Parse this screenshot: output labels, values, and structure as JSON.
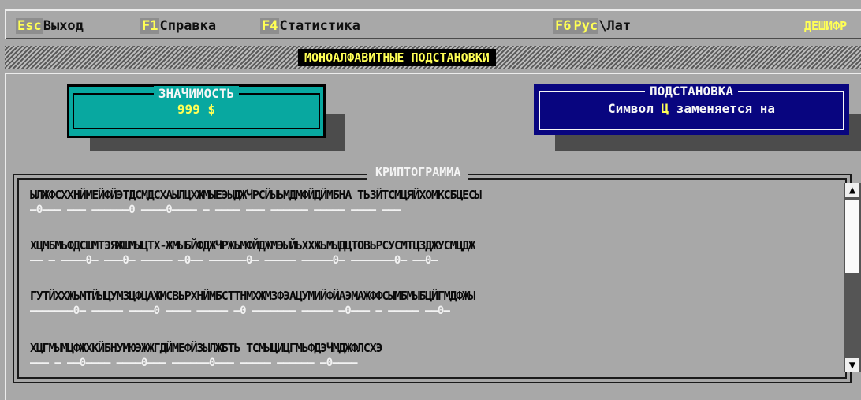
{
  "menu": {
    "esc": {
      "key": "Esc",
      "label": "Выход"
    },
    "f1": {
      "key": "F1",
      "label": "Справка"
    },
    "f4": {
      "key": "F4",
      "label": "Статистика"
    },
    "f6": {
      "key": "F6",
      "label_highlight": "Рус",
      "label_rest": "\\Лат"
    },
    "mode": "ДЕШИФР"
  },
  "title_strip": "МОНОАЛФАВИТНЫЕ ПОДСТАНОВКИ",
  "significance": {
    "title": "ЗНАЧИМОСТЬ",
    "value": "999 $"
  },
  "substitution": {
    "title": "ПОДСТАНОВКА",
    "text_before": "Символ ",
    "char": "Ц",
    "text_after": " заменяется на"
  },
  "cryptogram": {
    "title": "КРИПТОГРАММА",
    "lines": [
      {
        "text": "ЫЛЖФСХХНЙМЕЙФЙЭТДСМДСХАЫЛЦХЖМЫЕЭЫДЖЧРСЙЫЬМДМФЙДЙМБНА ТЬЗЙТСМЦЯЙХОМКСБЦЕСЫ",
        "under": "—0——— ——— ——————0 ————0———— — ———— ——— —————— ————— ———— ———"
      },
      {
        "text": "ХЦМБМЬФДСШМТЭЯЖШМЫЦТХ-ЖМЫБЙФДЖЧРЖЬМФЙДЖМЭЫЙЬХХЖЬМЫДЦТОВЬРСУСМТЦЗДЖУСМЦДЖ",
        "under": "—— — ————0— ———0— ————— —0—— ——————0— ————— —————0— ———————0— ——0—"
      },
      {
        "text": "ГУТЙХХЖЬМТЙЫЦУМЗЦФЦАЖМСВЬРХНЙМБСТТНМХЖМЗФЭАЦУМИЙФЙАЭМАЖФФСЫМБМЫБЦЙГМДФЖЫ",
        "under": "———————0— ————— ————0 ———— ————— —0 ——————— ————— —0——— — ————— ——0—"
      },
      {
        "text": "ХЦГМЫМЦФЖХКЙБНУМЮЭЖЖГДЙМЕФЙЗЫЛЖБТЬ ТСМЫЦИЦГМЬФДЭЧМДЖФЛСХЭ",
        "under": "——— — ——0———— ————0——— ——————0——— ————— —————— —0————"
      }
    ]
  },
  "colors": {
    "background": "#a8a8a8",
    "accent_yellow": "#ffff55",
    "significance_bg": "#08a8a0",
    "substitution_bg": "#08057f"
  },
  "icons": {
    "scroll_up": "▲",
    "scroll_down": "▼"
  }
}
